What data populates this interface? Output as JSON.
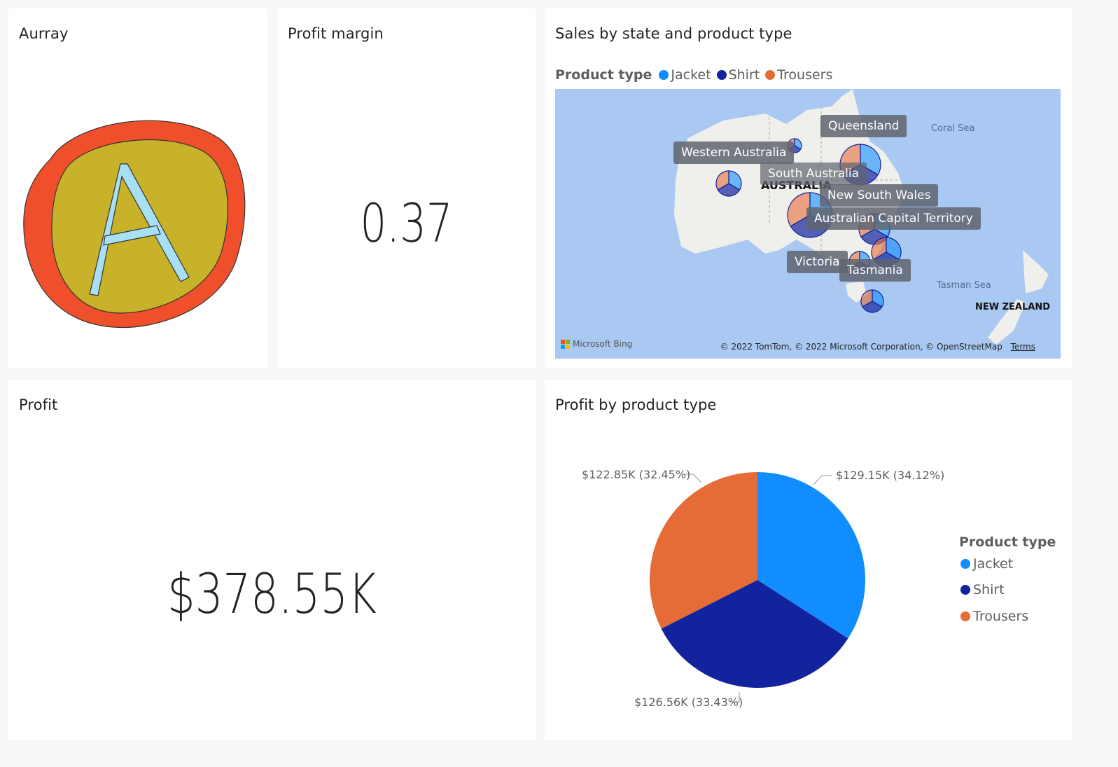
{
  "colors": {
    "jacket": "#118dff",
    "shirt": "#12239e",
    "trousers": "#e66c37",
    "logo_outer": "#ef4f2a",
    "logo_inner": "#c8b22a",
    "logo_letter": "#a7dff5"
  },
  "logo_tile": {
    "title": "Aurray",
    "letter": "A"
  },
  "margin_tile": {
    "title": "Profit margin",
    "value": "0.37"
  },
  "profit_tile": {
    "title": "Profit",
    "value": "$378.55K"
  },
  "map_tile": {
    "title": "Sales by state and product type",
    "legend_title": "Product type",
    "legend": [
      "Jacket",
      "Shirt",
      "Trousers"
    ],
    "state_labels": [
      "Queensland",
      "Western Australia",
      "South Australia",
      "New South Wales",
      "Australian Capital Territory",
      "Victoria",
      "Tasmania"
    ],
    "country_labels": [
      "AUSTRALIA",
      "NEW ZEALAND"
    ],
    "sea_labels": [
      "Coral Sea",
      "Tasman Sea"
    ],
    "attribution": "© 2022 TomTom, © 2022 Microsoft Corporation, © OpenStreetMap",
    "terms": "Terms",
    "bing": "Microsoft Bing"
  },
  "pie_tile": {
    "title": "Profit by product type",
    "legend_title": "Product type",
    "legend": [
      "Jacket",
      "Shirt",
      "Trousers"
    ]
  },
  "chart_data": {
    "type": "pie",
    "title": "Profit by product type",
    "legend_title": "Product type",
    "categories": [
      "Jacket",
      "Shirt",
      "Trousers"
    ],
    "values": [
      129.15,
      126.56,
      122.85
    ],
    "percent": [
      34.12,
      33.43,
      32.45
    ],
    "data_labels": [
      "$129.15K (34.12%)",
      "$126.56K (33.43%)",
      "$122.85K (32.45%)"
    ],
    "legend_position": "right"
  }
}
